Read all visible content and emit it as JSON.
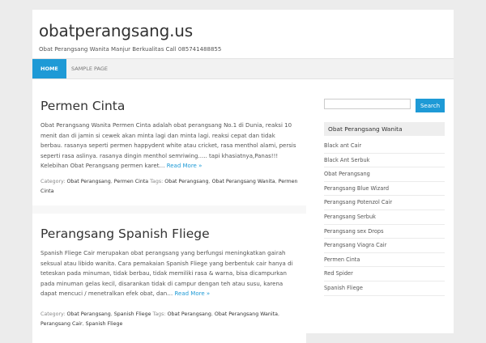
{
  "site": {
    "title": "obatperangsang.us",
    "description": "Obat Perangsang Wanita Manjur Berkualitas Call 085741488855"
  },
  "nav": {
    "items": [
      "HOME",
      "SAMPLE PAGE"
    ]
  },
  "posts": [
    {
      "title": "Permen Cinta",
      "excerpt": "  Obat Perangsang Wanita Permen Cinta adalah obat perangsang No.1 di Dunia, reaksi 10 menit dan di jamin si cewek akan minta lagi dan minta lagi. reaksi cepat dan tidak berbau. rasanya seperti permen happydent white atau cricket, rasa menthol alami, persis seperti rasa aslinya. rasanya dingin menthol semriwing….. tapi khasiatnya,Panas!!! Kelebihan Obat Perangsang permen karet…",
      "read_more": "Read More »",
      "category_label": "Category:",
      "categories": [
        "Obat Perangsang",
        "Permen Cinta"
      ],
      "tags_label": "Tags:",
      "tags": [
        "Obat Perangsang",
        "Obat Perangsang Wanita",
        "Permen Cinta"
      ]
    },
    {
      "title": "Perangsang Spanish Fliege",
      "excerpt": "Spanish Fliege Cair merupakan obat perangsang yang berfungsi meningkatkan gairah seksual atau libido wanita. Cara pemakaian Spanish Fliege yang berbentuk cair hanya di teteskan pada minuman, tidak berbau, tidak memiliki rasa & warna, bisa dicampurkan pada minuman gelas kecil, disarankan tidak di campur dengan teh atau susu, karena dapat mencuci / menetralkan efek obat, dan…",
      "read_more": "Read More »",
      "category_label": "Category:",
      "categories": [
        "Obat Perangsang",
        "Spanish Fliege"
      ],
      "tags_label": "Tags:",
      "tags": [
        "Obat Perangsang",
        "Obat Perangsang Wanita",
        "Perangsang Cair",
        "Spanish Fliege"
      ]
    }
  ],
  "sidebar": {
    "search_placeholder": "",
    "search_button": "Search",
    "widget_title": "Obat Perangsang Wanita",
    "categories": [
      "Black ant Cair",
      "Black Ant Serbuk",
      "Obat Perangsang",
      "Perangsang Blue Wizard",
      "Perangsang Potenzol Cair",
      "Perangsang Serbuk",
      "Perangsang sex Drops",
      "Perangsang Viagra Cair",
      "Permen Cinta",
      "Red Spider",
      "Spanish Fliege"
    ]
  },
  "colors": {
    "accent": "#1e9ad6",
    "background": "#ececec"
  }
}
